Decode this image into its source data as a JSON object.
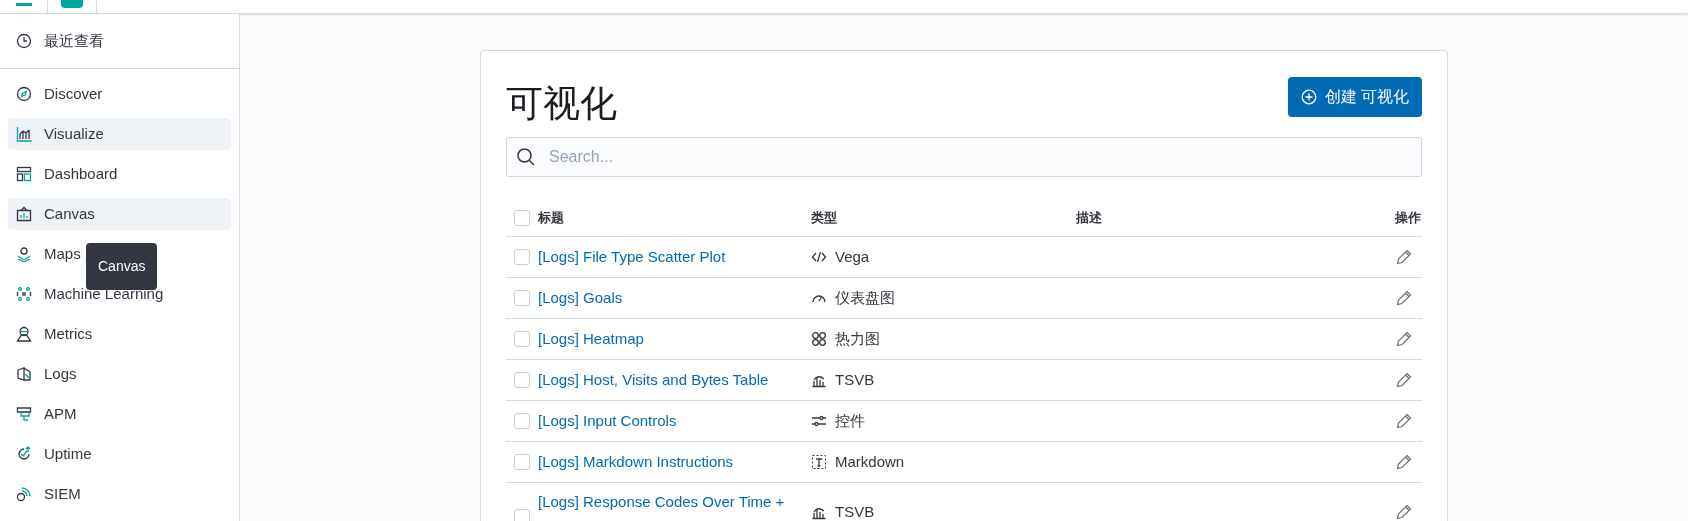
{
  "sidebar": {
    "recent": {
      "label": "最近查看"
    },
    "items": [
      {
        "label": "Discover",
        "highlighted": false
      },
      {
        "label": "Visualize",
        "highlighted": true
      },
      {
        "label": "Dashboard",
        "highlighted": false
      },
      {
        "label": "Canvas",
        "highlighted": true
      },
      {
        "label": "Maps",
        "highlighted": false
      },
      {
        "label": "Machine Learning",
        "highlighted": false
      },
      {
        "label": "Metrics",
        "highlighted": false
      },
      {
        "label": "Logs",
        "highlighted": false
      },
      {
        "label": "APM",
        "highlighted": false
      },
      {
        "label": "Uptime",
        "highlighted": false
      },
      {
        "label": "SIEM",
        "highlighted": false
      }
    ],
    "tooltip": "Canvas"
  },
  "page": {
    "title": "可视化",
    "create_button": "创建 可视化",
    "search": {
      "placeholder": "Search..."
    }
  },
  "table": {
    "select_all_checked": false,
    "columns": [
      "标题",
      "类型",
      "描述",
      "操作"
    ],
    "rows": [
      {
        "title": "[Logs] File Type Scatter Plot",
        "type": "Vega",
        "kind": "code",
        "checked": false
      },
      {
        "title": "[Logs] Goals",
        "type": "仪表盘图",
        "kind": "gauge",
        "checked": false
      },
      {
        "title": "[Logs] Heatmap",
        "type": "热力图",
        "kind": "heatmap",
        "checked": false
      },
      {
        "title": "[Logs] Host, Visits and Bytes Table",
        "type": "TSVB",
        "kind": "tsvb",
        "checked": false
      },
      {
        "title": "[Logs] Input Controls",
        "type": "控件",
        "kind": "controls",
        "checked": false
      },
      {
        "title": "[Logs] Markdown Instructions",
        "type": "Markdown",
        "kind": "markdown",
        "checked": false
      },
      {
        "title": "[Logs] Response Codes Over Time +",
        "type": "TSVB",
        "kind": "tsvb",
        "checked": false
      }
    ]
  }
}
